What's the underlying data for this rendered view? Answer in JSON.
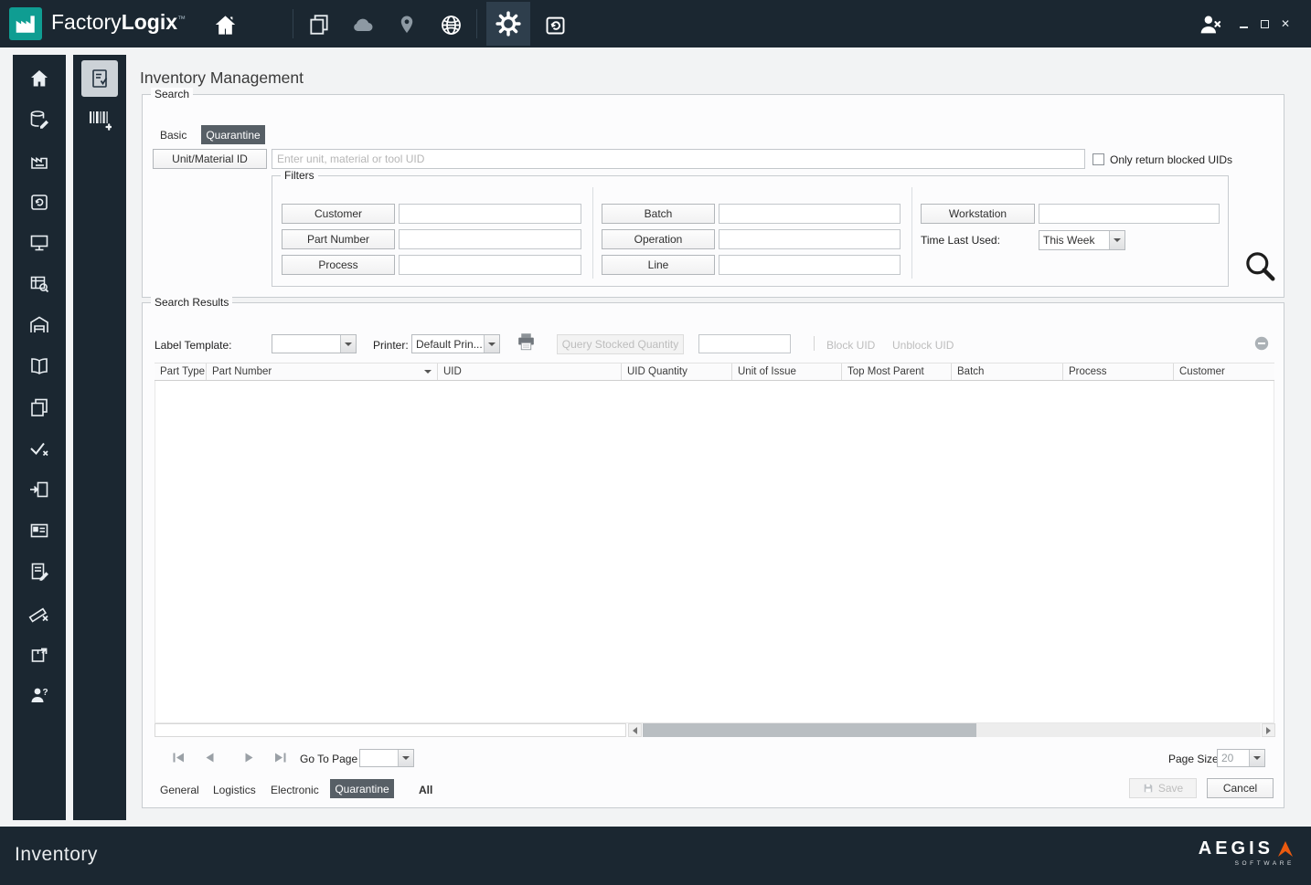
{
  "titlebar": {
    "brand_factory": "Factory",
    "brand_logix": "Logix",
    "brand_tm": "™"
  },
  "page": {
    "title": "Inventory Management"
  },
  "search": {
    "group_label": "Search",
    "tabs": [
      {
        "label": "Basic",
        "selected": false
      },
      {
        "label": "Quarantine",
        "selected": true
      }
    ],
    "unit_material_button": "Unit/Material ID",
    "uid_input_placeholder": "Enter unit, material or tool UID",
    "uid_input_value": "",
    "blocked_uids_checkbox": {
      "label": "Only return blocked UIDs",
      "checked": false
    },
    "filters": {
      "group_label": "Filters",
      "field_buttons_col1": [
        "Customer",
        "Part Number",
        "Process"
      ],
      "field_buttons_col2": [
        "Batch",
        "Operation",
        "Line"
      ],
      "workstation_button": "Workstation",
      "time_last_used_label": "Time Last Used:",
      "time_last_used_value": "This Week"
    }
  },
  "results": {
    "group_label": "Search Results",
    "label_template_label": "Label Template:",
    "label_template_value": "",
    "printer_label": "Printer:",
    "printer_value": "Default Prin...",
    "query_stocked_quantity_button": "Query Stocked Quantity",
    "stocked_quantity_value": "",
    "block_uid_button": "Block UID",
    "unblock_uid_button": "Unblock UID",
    "columns": [
      "Part Type",
      "Part Number",
      "UID",
      "UID Quantity",
      "Unit of Issue",
      "Top Most Parent",
      "Batch",
      "Process",
      "Customer"
    ],
    "rows": [],
    "pagination": {
      "go_to_page_label": "Go To Page",
      "go_to_page_value": "",
      "page_size_label": "Page Size",
      "page_size_value": "20"
    },
    "bottom_tabs": [
      {
        "label": "General",
        "selected": false
      },
      {
        "label": "Logistics",
        "selected": false
      },
      {
        "label": "Electronic",
        "selected": false
      },
      {
        "label": "Quarantine",
        "selected": true
      },
      {
        "label": "All",
        "selected": false
      }
    ],
    "save_button": "Save",
    "cancel_button": "Cancel"
  },
  "statusbar": {
    "module_label": "Inventory",
    "brand": "AEGIS",
    "brand_sub": "SOFTWARE"
  },
  "icons": {
    "topbar": [
      "factory-logo",
      "home",
      "copy-pages",
      "cloud",
      "location-pin",
      "globe",
      "gear",
      "history-box",
      "user-logout",
      "minimize",
      "maximize",
      "close"
    ],
    "sidebar": [
      "home",
      "database-edit",
      "factory",
      "box-history",
      "monitor",
      "table-search",
      "warehouse",
      "book",
      "copy-pages",
      "check-cancel",
      "import-box",
      "id-card",
      "document-edit",
      "ruler-cancel",
      "package-arrow",
      "user-question"
    ],
    "subsidebar": [
      "inventory-checklist",
      "barcode-add"
    ],
    "misc": [
      "search-magnifier",
      "printer",
      "remove-circle",
      "sort-arrow",
      "save-floppy",
      "pager-first",
      "pager-prev",
      "pager-next",
      "pager-last",
      "scroll-left",
      "scroll-right"
    ]
  },
  "colors": {
    "topbar_bg": "#1b2731",
    "accent_teal": "#0f9d92",
    "selected_tab_bg": "#575f66",
    "brand_orange": "#ea5a0f"
  }
}
